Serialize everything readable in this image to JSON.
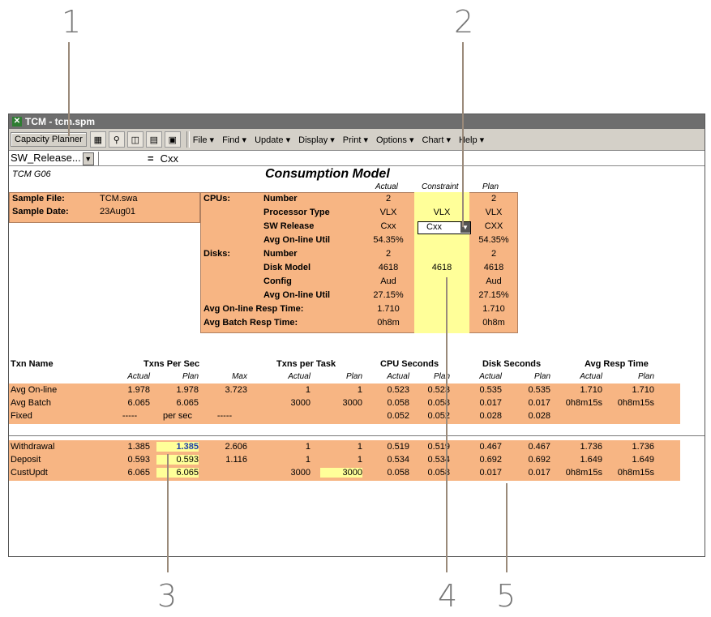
{
  "callouts": [
    "1",
    "2",
    "3",
    "4",
    "5"
  ],
  "window": {
    "title": "TCM - tcm.spm",
    "toolbar": {
      "planner_button": "Capacity Planner",
      "icons": [
        "chart-edit-icon",
        "search-icon",
        "view-icon",
        "table-icon",
        "calculator-icon"
      ],
      "menus": [
        "File ▾",
        "Find ▾",
        "Update ▾",
        "Display ▾",
        "Print ▾",
        "Options ▾",
        "Chart ▾",
        "Help ▾"
      ]
    },
    "formula_bar": {
      "name_box": "SW_Release...",
      "equals": "=",
      "value": "Cxx"
    }
  },
  "sheet": {
    "id": "TCM G06",
    "title": "Consumption Model",
    "col_heads": {
      "actual": "Actual",
      "constraint": "Constraint",
      "plan": "Plan"
    },
    "sample": {
      "file_label": "Sample File:",
      "file_value": "TCM.swa",
      "date_label": "Sample Date:",
      "date_value": "23Aug01"
    },
    "config": {
      "cpus_label": "CPUs:",
      "disks_label": "Disks:",
      "rows": [
        {
          "label": "Number",
          "actual": "2",
          "constraint": "",
          "plan": "2"
        },
        {
          "label": "Processor Type",
          "actual": "VLX",
          "constraint": "VLX",
          "plan": "VLX"
        },
        {
          "label": "SW Release",
          "actual": "Cxx",
          "constraint": "Cxx",
          "plan": "CXX"
        },
        {
          "label": "Avg On-line Util",
          "actual": "54.35%",
          "constraint": "",
          "plan": "54.35%"
        },
        {
          "label": "Number",
          "actual": "2",
          "constraint": "",
          "plan": "2"
        },
        {
          "label": "Disk Model",
          "actual": "4618",
          "constraint": "4618",
          "plan": "4618"
        },
        {
          "label": "Config",
          "actual": "Aud",
          "constraint": "",
          "plan": "Aud"
        },
        {
          "label": "Avg On-line Util",
          "actual": "27.15%",
          "constraint": "",
          "plan": "27.15%"
        },
        {
          "label": "Avg On-line Resp Time:",
          "actual": "1.710",
          "constraint": "",
          "plan": "1.710"
        },
        {
          "label": "Avg Batch Resp Time:",
          "actual": "0h8m",
          "constraint": "",
          "plan": "0h8m"
        }
      ]
    },
    "txn_table": {
      "group_heads": [
        "Txn Name",
        "Txns Per Sec",
        "Txns per Task",
        "CPU Seconds",
        "Disk Seconds",
        "Avg Resp Time"
      ],
      "sub_heads": [
        "Actual",
        "Plan",
        "Max",
        "Actual",
        "Plan",
        "Actual",
        "Plan",
        "Actual",
        "Plan",
        "Actual",
        "Plan"
      ],
      "summary_rows": [
        [
          "Avg On-line",
          "1.978",
          "1.978",
          "3.723",
          "1",
          "1",
          "0.523",
          "0.523",
          "0.535",
          "0.535",
          "1.710",
          "1.710"
        ],
        [
          "Avg Batch",
          "6.065",
          "6.065",
          "",
          "3000",
          "3000",
          "0.058",
          "0.058",
          "0.017",
          "0.017",
          "0h8m15s",
          "0h8m15s"
        ],
        [
          "Fixed",
          "-----",
          "per sec",
          "-----",
          "",
          "",
          "0.052",
          "0.052",
          "0.028",
          "0.028",
          "",
          ""
        ]
      ],
      "detail_rows": [
        [
          "Withdrawal",
          "1.385",
          "1.385",
          "2.606",
          "1",
          "1",
          "0.519",
          "0.519",
          "0.467",
          "0.467",
          "1.736",
          "1.736"
        ],
        [
          "Deposit",
          "0.593",
          "0.593",
          "1.116",
          "1",
          "1",
          "0.534",
          "0.534",
          "0.692",
          "0.692",
          "1.649",
          "1.649"
        ],
        [
          "CustUpdt",
          "6.065",
          "6.065",
          "",
          "3000",
          "3000",
          "0.058",
          "0.058",
          "0.017",
          "0.017",
          "0h8m15s",
          "0h8m15s"
        ]
      ]
    }
  },
  "colors": {
    "input_cell": "#f7b583",
    "editable_cell": "#ffff99",
    "highlight_text": "#1f3fa6"
  }
}
